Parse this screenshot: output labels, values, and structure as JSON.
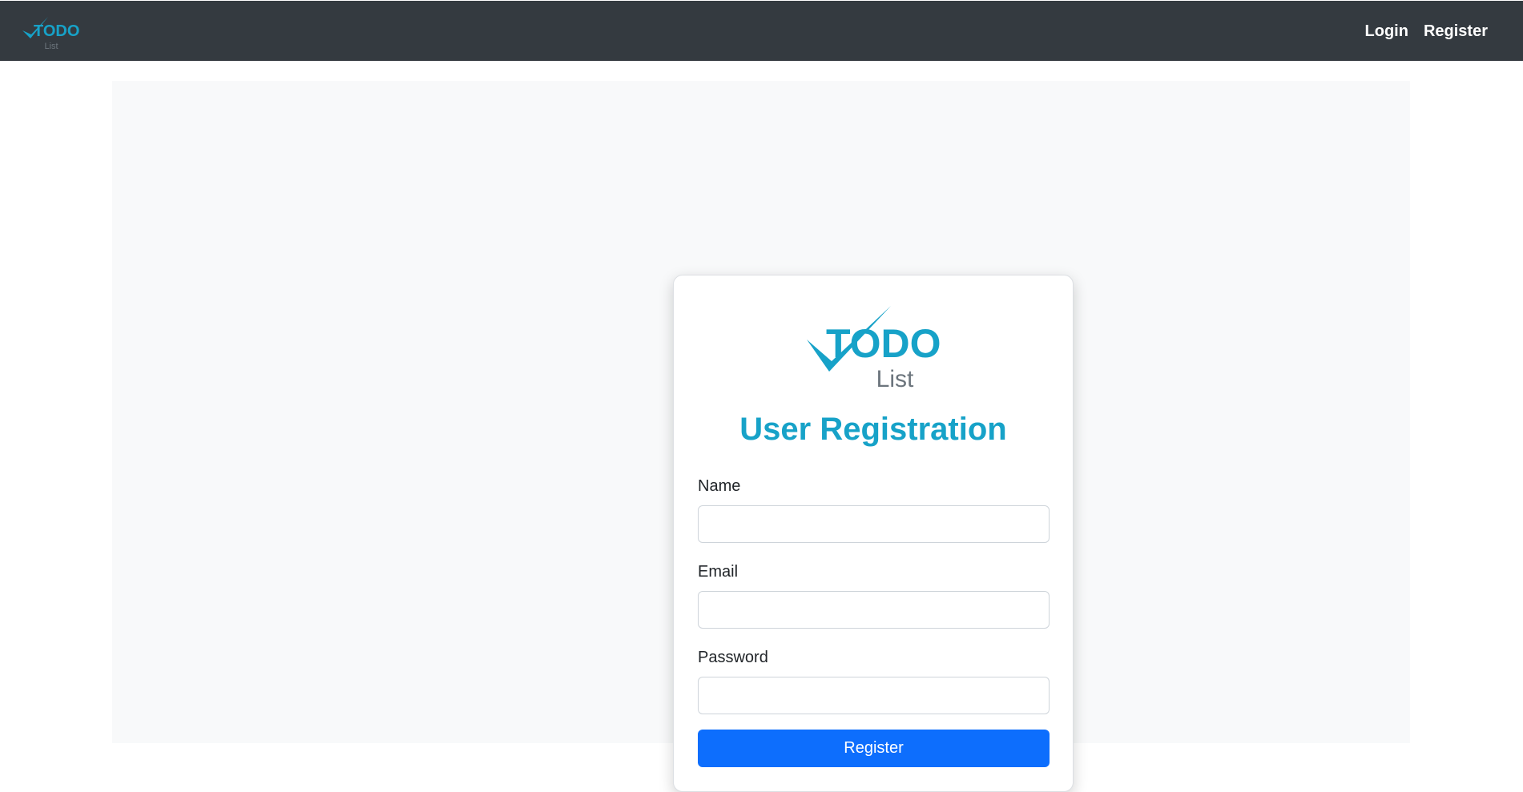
{
  "navbar": {
    "logo": {
      "word": "TODO",
      "sub": "List"
    },
    "links": {
      "login": "Login",
      "register": "Register"
    }
  },
  "card": {
    "logo": {
      "word": "TODO",
      "sub": "List"
    },
    "title": "User Registration",
    "fields": {
      "name": {
        "label": "Name",
        "value": "",
        "placeholder": ""
      },
      "email": {
        "label": "Email",
        "value": "",
        "placeholder": ""
      },
      "password": {
        "label": "Password",
        "value": "",
        "placeholder": ""
      }
    },
    "submit_label": "Register"
  },
  "colors": {
    "navbar_bg": "#343a40",
    "brand_teal": "#17a2c8",
    "logo_gray": "#6c757d",
    "primary_button": "#0d6efd",
    "panel_bg": "#f8f9fa"
  }
}
